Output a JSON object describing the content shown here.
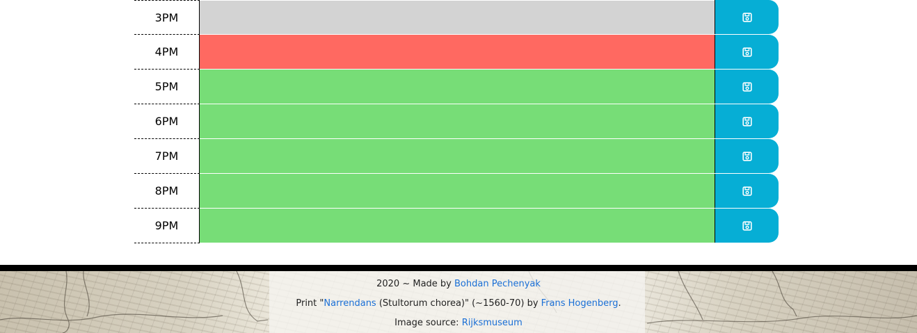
{
  "rows": [
    {
      "hour": "3PM",
      "state": "past"
    },
    {
      "hour": "4PM",
      "state": "present"
    },
    {
      "hour": "5PM",
      "state": "future"
    },
    {
      "hour": "6PM",
      "state": "future"
    },
    {
      "hour": "7PM",
      "state": "future"
    },
    {
      "hour": "8PM",
      "state": "future"
    },
    {
      "hour": "9PM",
      "state": "future"
    }
  ],
  "colors": {
    "past": "#d3d3d3",
    "present": "#ff6961",
    "future": "#77dd77",
    "save_button": "#06aed5",
    "link": "#1a6fd6"
  },
  "save_icon": "save-icon",
  "footer": {
    "line1_prefix": "2020 ~ Made by ",
    "author": "Bohdan Pechenyak",
    "line2_prefix": "Print \"",
    "artwork": "Narrendans",
    "line2_middle": " (Stultorum chorea)\" (~1560-70) by ",
    "artist": "Frans Hogenberg",
    "line2_suffix": ".",
    "line3_prefix": "Image source: ",
    "source": "Rijksmuseum"
  }
}
